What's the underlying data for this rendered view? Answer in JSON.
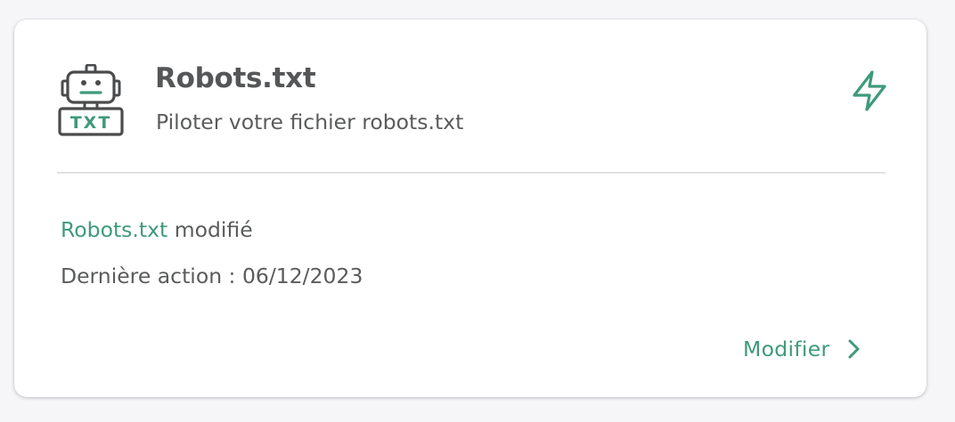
{
  "card": {
    "title": "Robots.txt",
    "subtitle": "Piloter votre fichier robots.txt",
    "icon": "robot-txt-icon",
    "icon_badge_text": "TXT",
    "action_icon": "lightning-bolt-icon"
  },
  "status": {
    "link_text": "Robots.txt",
    "suffix": " modifié",
    "last_action_label": "Dernière action : ",
    "last_action_date": "06/12/2023"
  },
  "footer": {
    "modify_label": "Modifier",
    "modify_icon": "chevron-right-icon"
  },
  "colors": {
    "accent": "#3e9a7a",
    "text": "#5a5b5c",
    "title": "#555657",
    "icon_dark": "#4a4b4c",
    "background": "#f6f6f8",
    "card": "#ffffff",
    "divider": "#e2e2e4"
  }
}
